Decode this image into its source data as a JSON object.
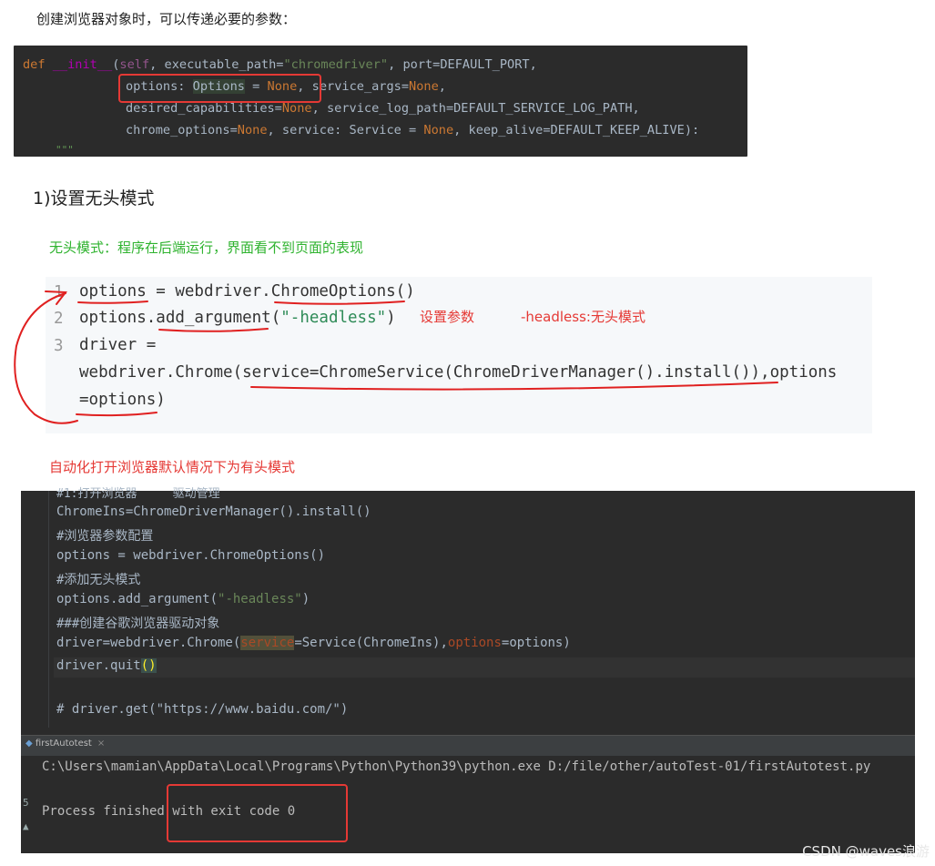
{
  "intro": "创建浏览器对象时，可以传递必要的参数：",
  "code1": {
    "line1": {
      "def": "def",
      "init": "__init__",
      "paren": "(",
      "self": "self",
      "rest1": ", executable_path=",
      "str": "\"chromedriver\"",
      "rest2": ", port=DEFAULT_PORT,"
    },
    "line2": {
      "a": "options: ",
      "b": "Options",
      "c": " = ",
      "d": "None",
      "e": ", service_args=",
      "f": "None",
      "g": ","
    },
    "line3": {
      "a": "desired_capabilities=",
      "b": "None",
      "c": ", service_log_path=DEFAULT_SERVICE_LOG_PATH,"
    },
    "line4": {
      "a": "chrome_options=",
      "b": "None",
      "c": ", service: Service = ",
      "d": "None",
      "e": ", keep_alive=DEFAULT_KEEP_ALIVE):"
    },
    "line5": "\"\"\""
  },
  "heading": "1)设置无头模式",
  "green_note": "无头模式：程序在后端运行，界面看不到页面的表现",
  "code2": {
    "n1": "1",
    "l1": "options = webdriver.ChromeOptions()",
    "n2": "2",
    "l2a": "options.add_argument(",
    "l2b": "\"-headless\"",
    "l2c": ")",
    "n3": "3",
    "l3": "driver =",
    "l4": "webdriver.Chrome(service=ChromeService(ChromeDriverManager().install()),options",
    "l5": "=options)",
    "annot1": "设置参数",
    "annot2": "-headless:无头模式"
  },
  "red_note": "自动化打开浏览器默认情况下为有头模式",
  "code3": {
    "partial": "#1:打开浏览器     驱动管理",
    "l1": "ChromeIns=ChromeDriverManager().install()",
    "c1": "#浏览器参数配置",
    "l2": "options = webdriver.ChromeOptions()",
    "c2": "#添加无头模式",
    "l3a": "options.add_argument(",
    "l3b": "\"-headless\"",
    "l3c": ")",
    "c3": "###创建谷歌浏览器驱动对象",
    "l4a": "driver=webdriver.Chrome(",
    "l4b": "service",
    "l4c": "=Service(ChromeIns)",
    "l4d": ",",
    "l4e": "options",
    "l4f": "=options)",
    "l5a": "driver.quit",
    "l5b": "()",
    "c4": "# driver.get(\"https://www.baidu.com/\")"
  },
  "run": {
    "tab": "firstAutotest",
    "tab_close": "×",
    "cmd": "C:\\Users\\mamian\\AppData\\Local\\Programs\\Python\\Python39\\python.exe D:/file/other/autoTest-01/firstAutotest.py",
    "result": "Process finished with exit code 0"
  },
  "watermark": "CSDN @waves浪游"
}
